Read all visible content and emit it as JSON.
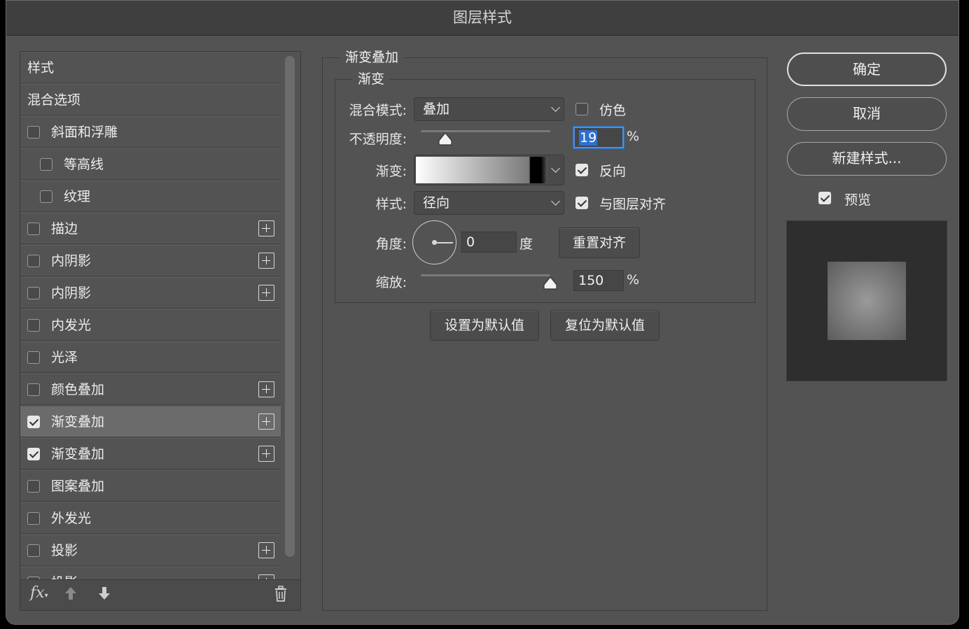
{
  "window": {
    "title": "图层样式"
  },
  "styles_list": {
    "header_items": [
      "样式",
      "混合选项"
    ],
    "items": [
      {
        "label": "斜面和浮雕",
        "checked": false,
        "plus": false,
        "indent": 0
      },
      {
        "label": "等高线",
        "checked": false,
        "plus": false,
        "indent": 1
      },
      {
        "label": "纹理",
        "checked": false,
        "plus": false,
        "indent": 1
      },
      {
        "label": "描边",
        "checked": false,
        "plus": true,
        "indent": 0
      },
      {
        "label": "内阴影",
        "checked": false,
        "plus": true,
        "indent": 0
      },
      {
        "label": "内阴影",
        "checked": false,
        "plus": true,
        "indent": 0
      },
      {
        "label": "内发光",
        "checked": false,
        "plus": false,
        "indent": 0
      },
      {
        "label": "光泽",
        "checked": false,
        "plus": false,
        "indent": 0
      },
      {
        "label": "颜色叠加",
        "checked": false,
        "plus": true,
        "indent": 0
      },
      {
        "label": "渐变叠加",
        "checked": true,
        "plus": true,
        "indent": 0,
        "selected": true
      },
      {
        "label": "渐变叠加",
        "checked": true,
        "plus": true,
        "indent": 0
      },
      {
        "label": "图案叠加",
        "checked": false,
        "plus": false,
        "indent": 0
      },
      {
        "label": "外发光",
        "checked": false,
        "plus": false,
        "indent": 0
      },
      {
        "label": "投影",
        "checked": false,
        "plus": true,
        "indent": 0
      }
    ],
    "partial_item": "投影",
    "bottom_icons": [
      "fx-icon",
      "move-up-icon",
      "move-down-icon",
      "trash-icon"
    ]
  },
  "gradient_overlay": {
    "section_title": "渐变叠加",
    "subsection_title": "渐变",
    "blend_mode_label": "混合模式:",
    "blend_mode_value": "叠加",
    "dither_label": "仿色",
    "dither_checked": false,
    "opacity_label": "不透明度:",
    "opacity_value": "19",
    "opacity_unit": "%",
    "opacity_fraction": 0.19,
    "gradient_label": "渐变:",
    "reverse_label": "反向",
    "reverse_checked": true,
    "style_label": "样式:",
    "style_value": "径向",
    "align_label": "与图层对齐",
    "align_checked": true,
    "angle_label": "角度:",
    "angle_value": "0",
    "angle_unit": "度",
    "reset_align_button": "重置对齐",
    "scale_label": "缩放:",
    "scale_value": "150",
    "scale_unit": "%",
    "scale_fraction": 1.0,
    "set_default_button": "设置为默认值",
    "reset_default_button": "复位为默认值"
  },
  "actions": {
    "ok": "确定",
    "cancel": "取消",
    "new_style": "新建样式...",
    "preview_label": "预览",
    "preview_checked": true
  },
  "colors": {
    "dialog_bg": "#535353",
    "titlebar_bg": "#3f3f3f",
    "focus_blue": "#4d8fe0"
  }
}
